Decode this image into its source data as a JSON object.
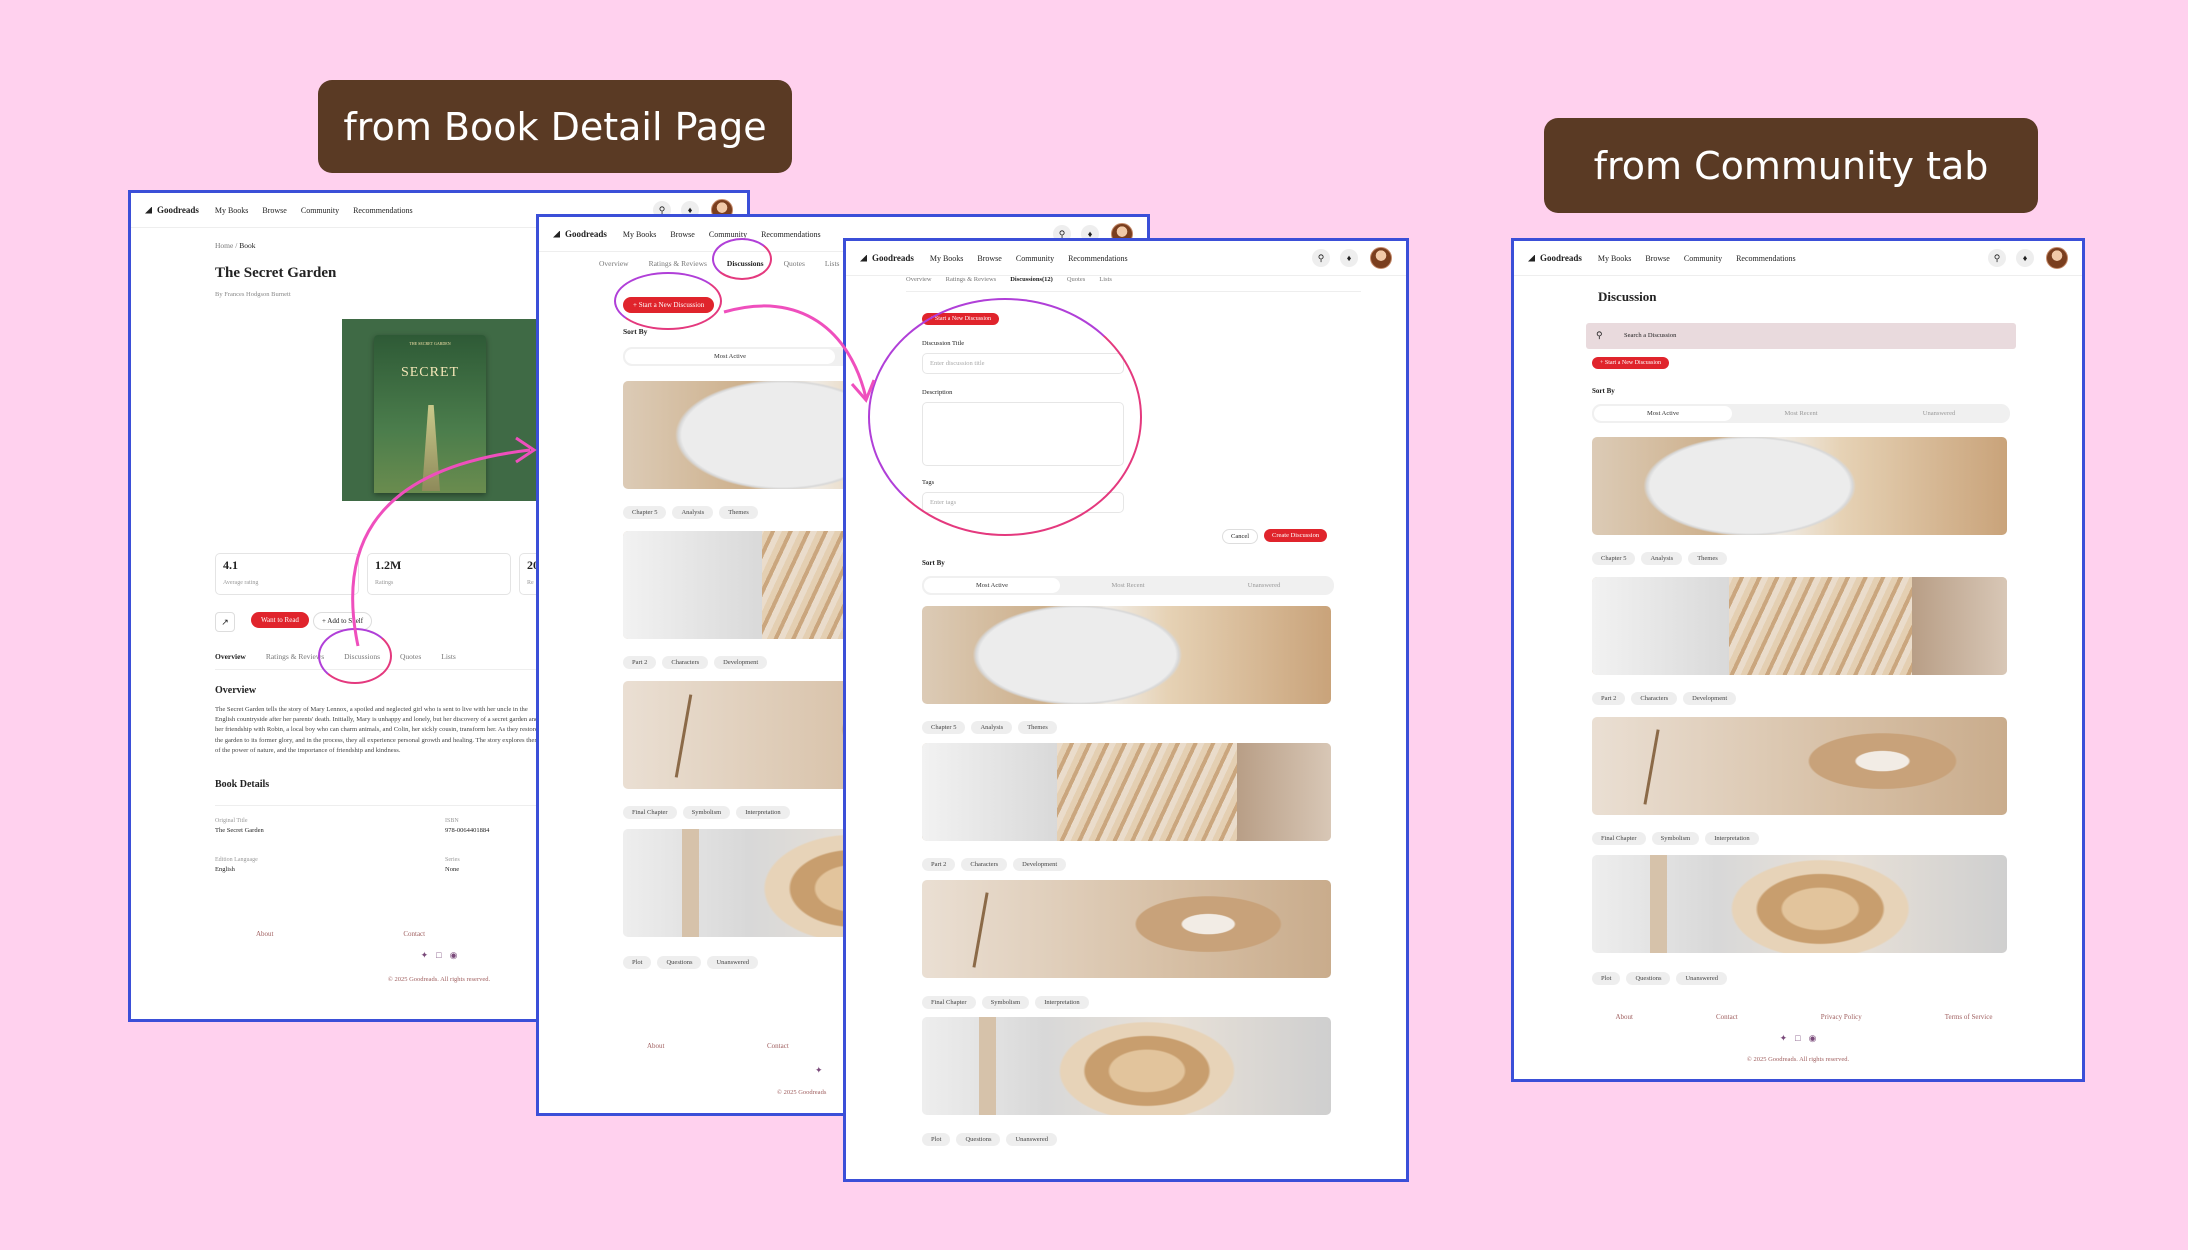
{
  "labels": {
    "left": "from Book Detail Page",
    "right": "from Community tab"
  },
  "nav": {
    "brand": "Goodreads",
    "my_books": "My Books",
    "browse": "Browse",
    "community": "Community",
    "recommendations": "Recommendations"
  },
  "book": {
    "crumb_home": "Home",
    "crumb_sep": "/",
    "crumb_book": "Book",
    "title": "The Secret Garden",
    "author": "By Frances Hodgson Burnett",
    "cover_title": "SECRET",
    "cover_small": "THE SECRET GARDEN",
    "stat1_val": "4.1",
    "stat1_lab": "Average rating",
    "stat2_val": "1.2M",
    "stat2_lab": "Ratings",
    "stat3_val": "20",
    "stat3_lab": "Re",
    "want": "Want to Read",
    "add": "+ Add to Shelf",
    "tab_overview": "Overview",
    "tab_ratings": "Ratings & Reviews",
    "tab_discussions": "Discussions",
    "tab_quotes": "Quotes",
    "tab_lists": "Lists",
    "overview_h": "Overview",
    "overview_text": "The Secret Garden tells the story of Mary Lennox, a spoiled and neglected girl who is sent to live with her uncle in the English countryside after her parents' death. Initially, Mary is unhappy and lonely, but her discovery of a secret garden and her friendship with Robin, a local boy who can charm animals, and Colin, her sickly cousin, transform her. As they restore the garden to its former glory, and in the process, they all experience personal growth and healing. The story explores themes of the power of nature, and the importance of friendship and kindness.",
    "details_h": "Book Details",
    "d1_lab": "Original Title",
    "d1_val": "The Secret Garden",
    "d2_lab": "ISBN",
    "d2_val": "978-0064401884",
    "d3_lab": "Edition Language",
    "d3_val": "English",
    "d4_lab": "Series",
    "d4_val": "None"
  },
  "tabs2": {
    "overview": "Overview",
    "ratings": "Ratings & Reviews",
    "discussions": "Discussions",
    "quotes": "Quotes",
    "lists": "Lists"
  },
  "tabs3": {
    "overview": "Overview",
    "ratings": "Ratings & Reviews",
    "discussions": "Discussions(12)",
    "quotes": "Quotes",
    "lists": "Lists"
  },
  "disc": {
    "start": "+ Start a New Discussion",
    "sort_by": "Sort By",
    "most_active": "Most Active",
    "most_recent": "Most Recent",
    "unanswered": "Unanswered",
    "title_lab": "Discussion Title",
    "title_ph": "Enter discussion title",
    "desc_lab": "Description",
    "tags_lab": "Tags",
    "tags_ph": "Enter tags",
    "cancel": "Cancel",
    "create": "Create Discussion",
    "page_title": "Discussion",
    "search_ph": "Search a Discussion",
    "g1": [
      "Chapter 5",
      "Analysis",
      "Themes"
    ],
    "g2": [
      "Part 2",
      "Characters",
      "Development"
    ],
    "g3": [
      "Final Chapter",
      "Symbolism",
      "Interpretation"
    ],
    "g4": [
      "Plot",
      "Questions",
      "Unanswered"
    ]
  },
  "footer": {
    "about": "About",
    "contact": "Contact",
    "privacy": "Privacy Policy",
    "terms": "Terms of Service",
    "copyright": "© 2025 Goodreads. All rights reserved.",
    "copy_short": "© 2025 Goodreads"
  }
}
